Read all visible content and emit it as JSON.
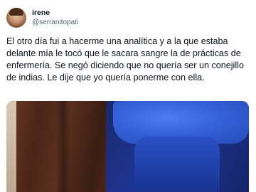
{
  "tweet": {
    "display_name": "irene",
    "handle": "@serranitopati",
    "text": "El otro día fui a hacerme una analítica y a la que estaba delante mía le tocó que le sacara sangre la de prácticas de enfermería. Se negó diciendo que no quería ser un conejillo de indias. Le dije que yo quería ponerme con ella."
  },
  "colors": {
    "text": "#0f1419",
    "secondary_text": "#536471"
  },
  "media": {
    "icon": "photo-attachment"
  }
}
